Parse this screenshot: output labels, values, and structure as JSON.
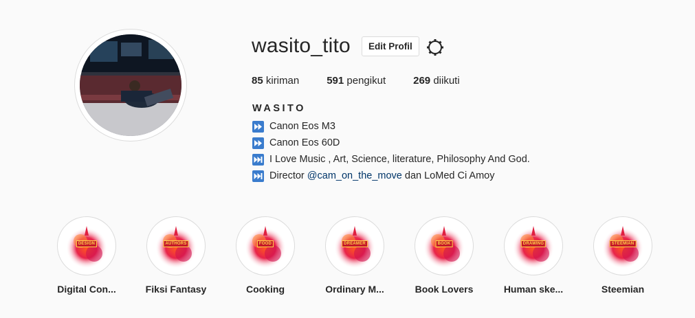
{
  "profile": {
    "username": "wasito_tito",
    "edit_button": "Edit Profil",
    "settings_icon": "gear-icon",
    "avatar_icon": "profile-photo"
  },
  "stats": {
    "posts_count": "85",
    "posts_label": "kiriman",
    "followers_count": "591",
    "followers_label": "pengikut",
    "following_count": "269",
    "following_label": "diikuti"
  },
  "bio": {
    "fullname": "WASITO",
    "lines": [
      {
        "icon": "fast-forward-icon",
        "text": "Canon Eos M3"
      },
      {
        "icon": "fast-forward-icon",
        "text": "Canon Eos 60D"
      },
      {
        "icon": "next-track-icon",
        "text": "I Love Music , Art, Science, literature, Philosophy And God."
      },
      {
        "icon": "next-track-icon",
        "text_before": "Director ",
        "mention": "@cam_on_the_move",
        "text_after": " dan LoMed Ci Amoy"
      }
    ]
  },
  "highlights": [
    {
      "tag": "DESIGN",
      "label": "Digital Con..."
    },
    {
      "tag": "AUTHORS",
      "label": "Fiksi Fantasy"
    },
    {
      "tag": "FOOD",
      "label": "Cooking"
    },
    {
      "tag": "DREAMER",
      "label": "Ordinary M..."
    },
    {
      "tag": "BOOK",
      "label": "Book Lovers"
    },
    {
      "tag": "DRAWING",
      "label": "Human ske..."
    },
    {
      "tag": "STEEMIAN",
      "label": "Steemian"
    }
  ],
  "colors": {
    "background": "#fafafa",
    "text": "#262626",
    "border": "#dbdbdb",
    "mention": "#003569",
    "bio_icon": "#3a7ccd"
  }
}
